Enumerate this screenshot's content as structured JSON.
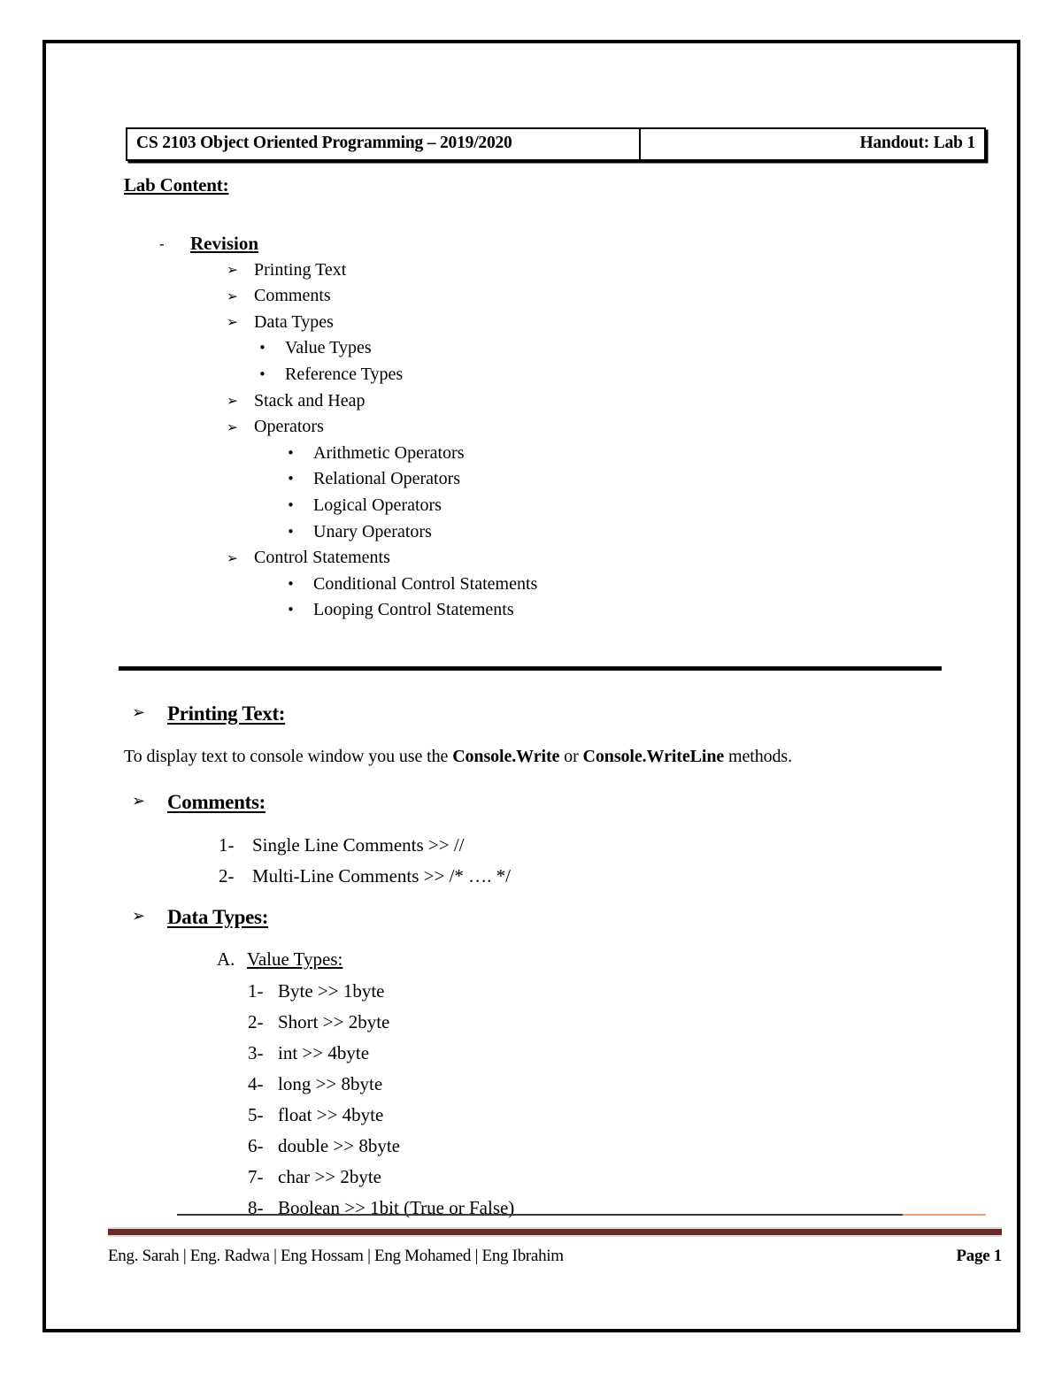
{
  "header": {
    "course": "CS 2103 Object Oriented Programming – 2019/2020",
    "handout": "Handout: Lab 1"
  },
  "lab_content": {
    "title": "Lab Content:",
    "outline": [
      {
        "level": 1,
        "bullet": "-",
        "label": "Revision"
      },
      {
        "level": 2,
        "bullet": "➢",
        "label": "Printing Text"
      },
      {
        "level": 2,
        "bullet": "➢",
        "label": "Comments"
      },
      {
        "level": 2,
        "bullet": "➢",
        "label": "Data Types"
      },
      {
        "level": "3a",
        "bullet": "•",
        "label": "Value Types"
      },
      {
        "level": "3a",
        "bullet": "•",
        "label": "Reference Types"
      },
      {
        "level": 2,
        "bullet": "➢",
        "label": "Stack and Heap"
      },
      {
        "level": 2,
        "bullet": "➢",
        "label": "Operators"
      },
      {
        "level": "3b",
        "bullet": "•",
        "label": "Arithmetic Operators"
      },
      {
        "level": "3b",
        "bullet": "•",
        "label": "Relational Operators"
      },
      {
        "level": "3b",
        "bullet": "•",
        "label": "Logical Operators"
      },
      {
        "level": "3b",
        "bullet": "•",
        "label": "Unary Operators"
      },
      {
        "level": 2,
        "bullet": "➢",
        "label": "Control Statements"
      },
      {
        "level": "3b",
        "bullet": "•",
        "label": "Conditional Control Statements"
      },
      {
        "level": "3b",
        "bullet": "•",
        "label": "Looping Control Statements"
      }
    ]
  },
  "sections": {
    "printing_text": {
      "bullet": "➢",
      "heading": "Printing Text:",
      "paragraph_pre": "To display text to console window you use the ",
      "paragraph_code1": "Console.Write",
      "paragraph_mid": " or ",
      "paragraph_code2": "Console.WriteLine",
      "paragraph_post": " methods."
    },
    "comments": {
      "bullet": "➢",
      "heading": "Comments:",
      "items": [
        {
          "num": "1-",
          "text": "Single Line Comments >> //"
        },
        {
          "num": "2-",
          "text": "Multi-Line Comments >> /* …. */"
        }
      ]
    },
    "data_types": {
      "bullet": "➢",
      "heading": "Data Types:",
      "subsection": {
        "marker": "A.",
        "title": "Value Types:",
        "items": [
          {
            "num": "1-",
            "text": "Byte  >>  1byte"
          },
          {
            "num": "2-",
            "text": "Short >>  2byte"
          },
          {
            "num": "3-",
            "text": "int >> 4byte"
          },
          {
            "num": "4-",
            "text": "long  >>  8byte"
          },
          {
            "num": "5-",
            "text": " float >> 4byte"
          },
          {
            "num": "6-",
            "text": "double >> 8byte"
          },
          {
            "num": "7-",
            "text": "char >> 2byte"
          },
          {
            "num": "8-",
            "text": "Boolean >>  1bit (True or False)"
          }
        ]
      }
    }
  },
  "footer": {
    "authors": "Eng. Sarah | Eng. Radwa | Eng Hossam | Eng Mohamed | Eng Ibrahim",
    "page": "Page 1",
    "accent_color": "#f0a070",
    "rule_color": "#6b2a2a"
  }
}
